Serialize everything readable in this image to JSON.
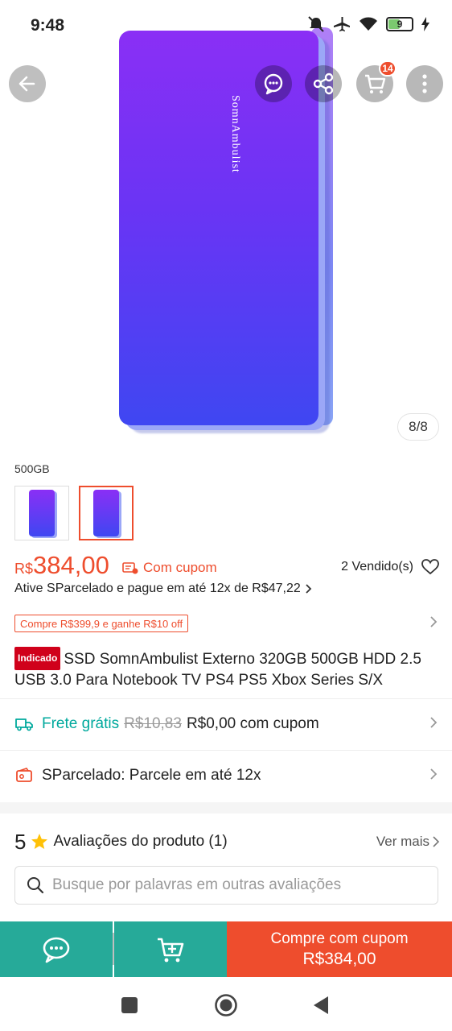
{
  "status_bar": {
    "time": "9:48",
    "battery": "9"
  },
  "product_image": {
    "brand_text": "SomnAmbulist",
    "counter": "8/8"
  },
  "top_actions": {
    "cart_badge": "14"
  },
  "variants": {
    "label": "500GB",
    "selected_index": 1
  },
  "price": {
    "currency": "R$",
    "value": "384,00",
    "coupon_label": "Com cupom",
    "sold": "2 Vendido(s)"
  },
  "installments": {
    "text": "Ative SParcelado e pague em até 12x de R$47,22"
  },
  "promo": {
    "tag": "Compre R$399,9 e ganhe R$10 off"
  },
  "title": {
    "badge": "Indicado",
    "text": "SSD SomnAmbulist Externo 320GB 500GB HDD 2.5 USB 3.0 Para Notebook TV PS4 PS5 Xbox Series S/X"
  },
  "shipping": {
    "label": "Frete grátis",
    "old_price": "R$10,83",
    "new_price": "R$0,00 com cupom"
  },
  "sparcelado": {
    "text": "SParcelado: Parcele em até 12x"
  },
  "reviews": {
    "rating": "5",
    "title": "Avaliações do produto (1)",
    "see_more": "Ver mais",
    "search_placeholder": "Busque por palavras em outras avaliações"
  },
  "action_bar": {
    "buy_line1": "Compre com cupom",
    "buy_line2": "R$384,00"
  },
  "colors": {
    "accent": "#ee4d2d",
    "teal": "#26aa99",
    "device_top": "#8a2ff5",
    "device_bottom": "#3f47f2"
  }
}
